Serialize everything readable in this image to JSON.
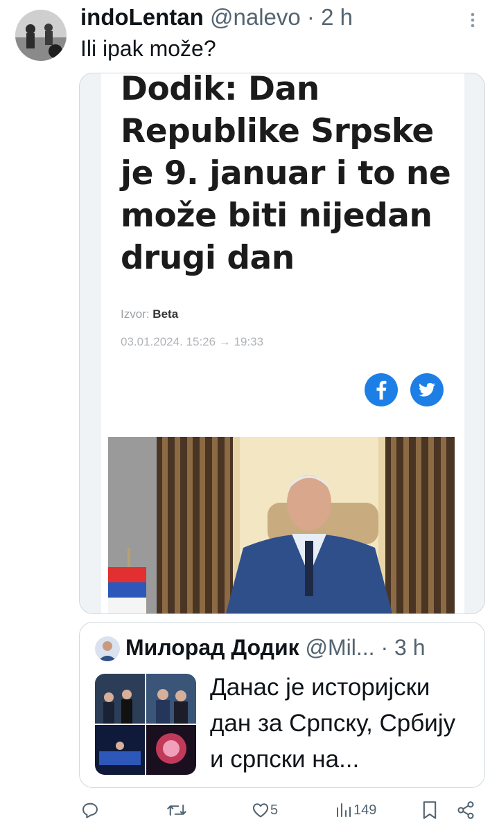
{
  "tweet": {
    "display_name": "indoLentan",
    "handle": "@nalevo",
    "separator": "·",
    "time": "2 h",
    "text": "Ili ipak može?"
  },
  "article": {
    "headline": "Dodik: Dan Republike Srpske je 9. januar i to ne može biti nijedan drugi dan",
    "source_label": "Izvor:",
    "source_name": "Beta",
    "date": "03.01.2024. 15:26 → 19:33"
  },
  "quote": {
    "display_name": "Милорад Додик",
    "handle": "@Mil...",
    "separator": "·",
    "time": "3 h",
    "text": "Данас је историјски дан за Српску, Србију и српски на..."
  },
  "actions": {
    "likes": "5",
    "views": "149"
  },
  "icons": [
    "more-icon",
    "facebook-icon",
    "twitter-icon",
    "reply-icon",
    "retweet-icon",
    "like-icon",
    "views-icon",
    "bookmark-icon",
    "share-icon"
  ],
  "colors": {
    "accent": "#1d7fe6",
    "muted": "#536471",
    "border": "#cfd9de"
  }
}
